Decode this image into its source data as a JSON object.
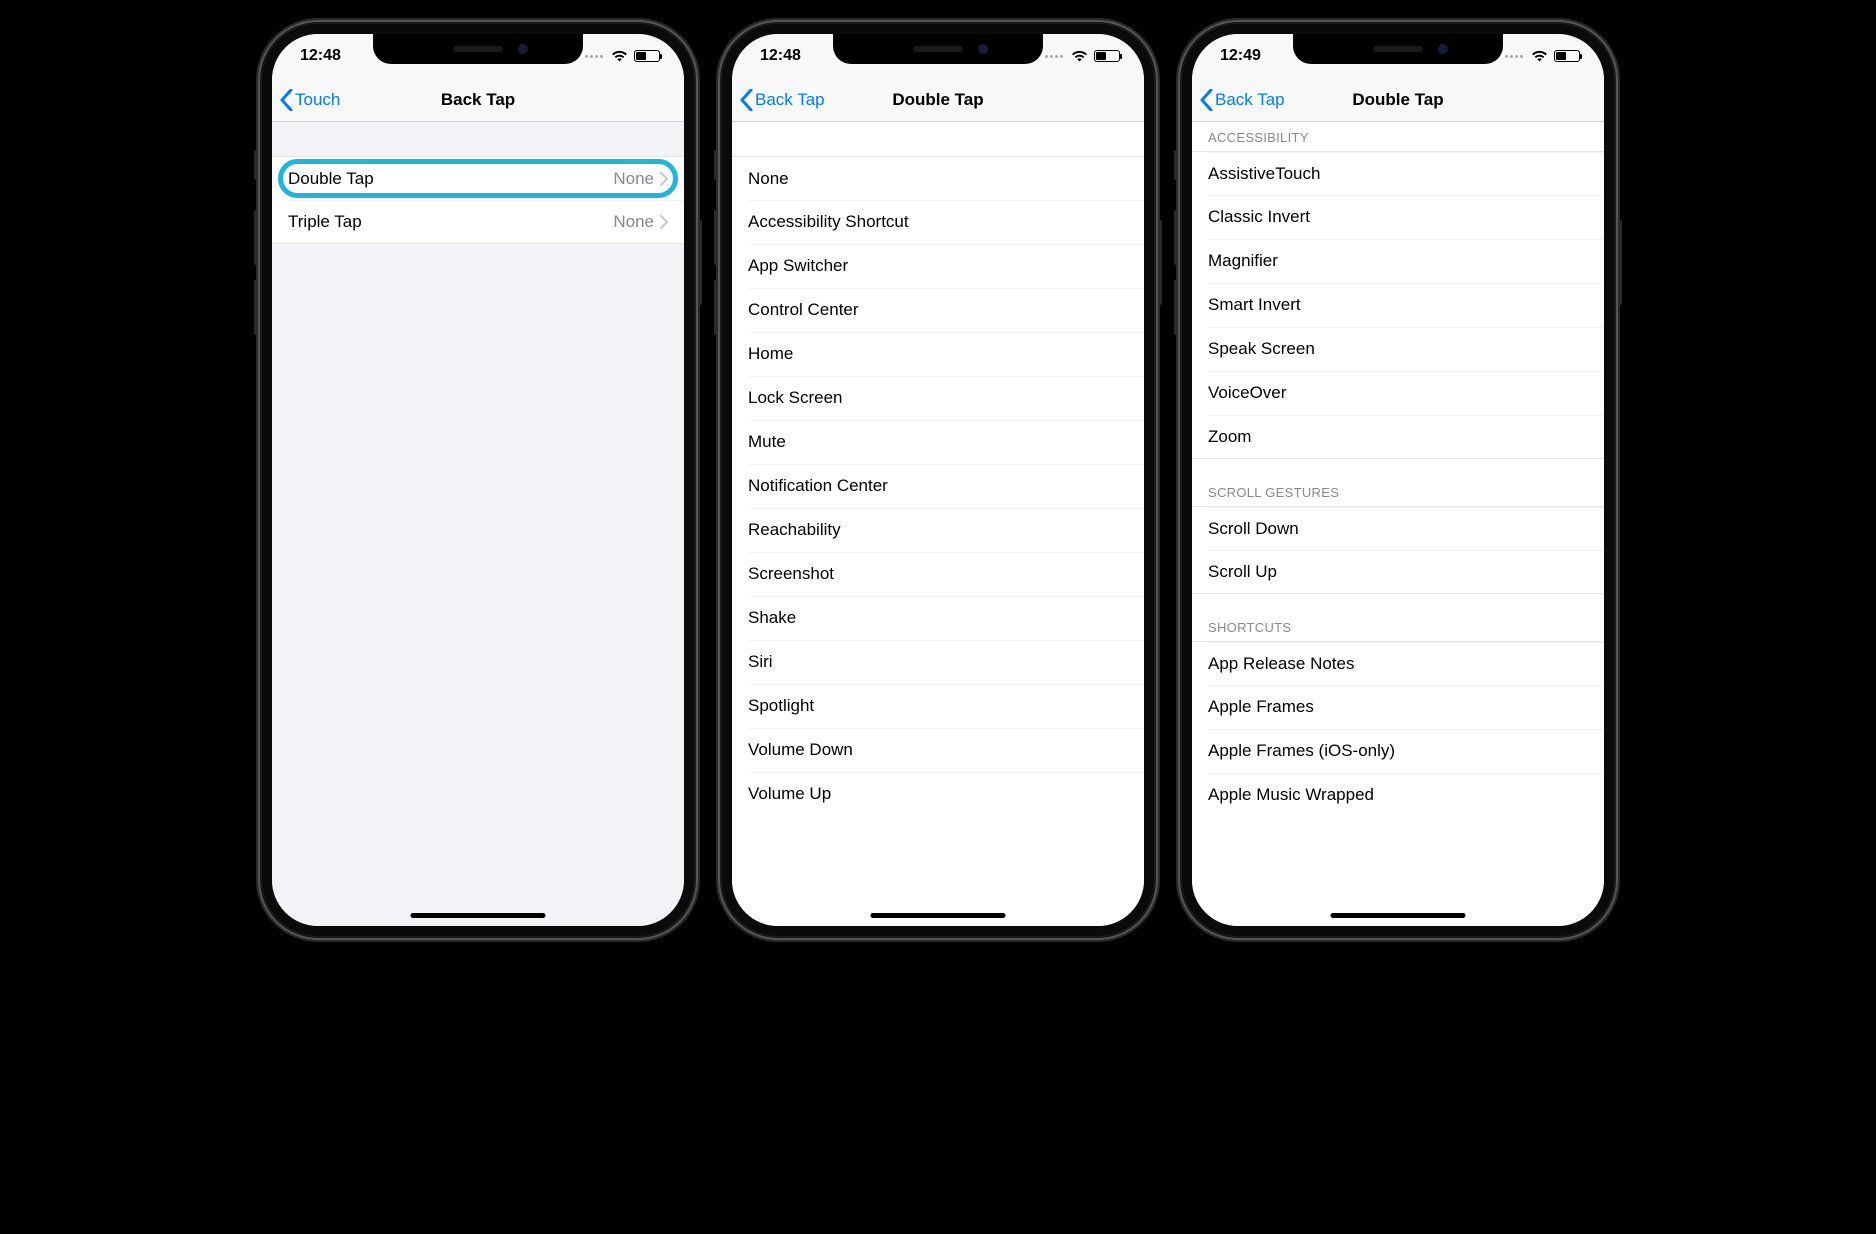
{
  "phone1": {
    "time": "12:48",
    "back_label": "Touch",
    "title": "Back Tap",
    "rows": [
      {
        "label": "Double Tap",
        "value": "None",
        "highlight": true
      },
      {
        "label": "Triple Tap",
        "value": "None",
        "highlight": false
      }
    ]
  },
  "phone2": {
    "time": "12:48",
    "back_label": "Back Tap",
    "title": "Double Tap",
    "rows": [
      "None",
      "Accessibility Shortcut",
      "App Switcher",
      "Control Center",
      "Home",
      "Lock Screen",
      "Mute",
      "Notification Center",
      "Reachability",
      "Screenshot",
      "Shake",
      "Siri",
      "Spotlight",
      "Volume Down",
      "Volume Up"
    ]
  },
  "phone3": {
    "time": "12:49",
    "back_label": "Back Tap",
    "title": "Double Tap",
    "sections": [
      {
        "header": "Accessibility",
        "rows": [
          "AssistiveTouch",
          "Classic Invert",
          "Magnifier",
          "Smart Invert",
          "Speak Screen",
          "VoiceOver",
          "Zoom"
        ]
      },
      {
        "header": "Scroll Gestures",
        "rows": [
          "Scroll Down",
          "Scroll Up"
        ]
      },
      {
        "header": "Shortcuts",
        "rows": [
          "App Release Notes",
          "Apple Frames",
          "Apple Frames (iOS-only)",
          "Apple Music Wrapped"
        ]
      }
    ]
  }
}
